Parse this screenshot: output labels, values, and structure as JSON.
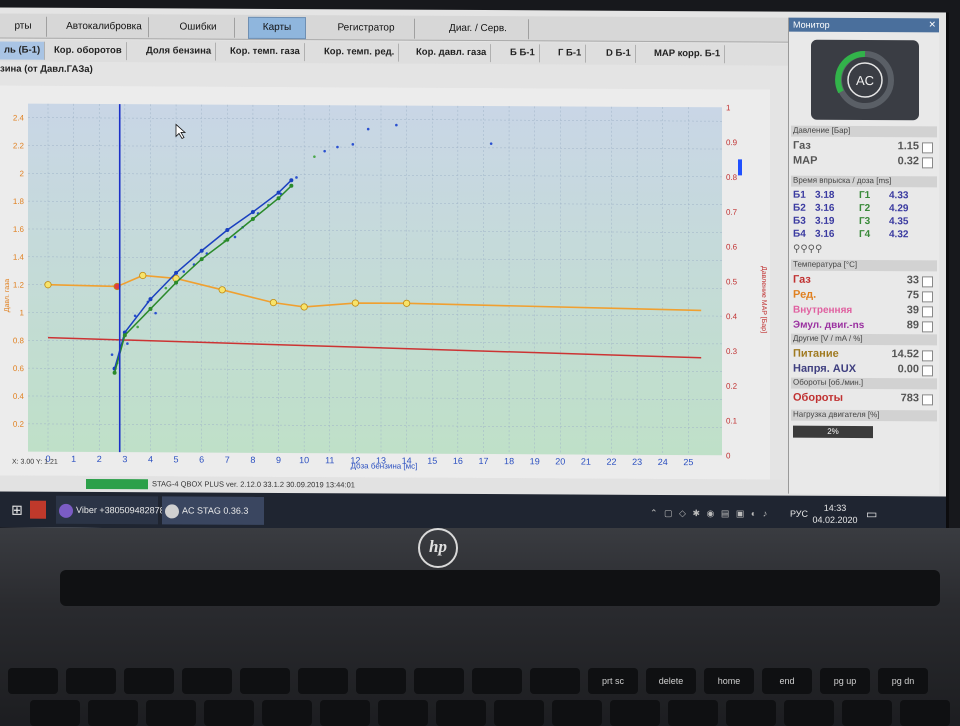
{
  "tabs": [
    "рты",
    "Автокалибровка",
    "Ошибки",
    "Карты",
    "Регистратор",
    "Диаг. / Серв."
  ],
  "active_tab": "Карты",
  "subtabs": [
    "ль (Б-1)",
    "Кор. оборотов",
    "Доля бензина",
    "Кор. темп. газа",
    "Кор. темп. ред.",
    "Кор. давл. газа",
    "Б Б-1",
    "Г Б-1",
    "D Б-1",
    "MAP корр. Б-1"
  ],
  "subtab_row2": "зина (от Давл.ГАЗа)",
  "left_axis_label": "Давл. газа",
  "right_axis_label": "Давление MAP [Бар]",
  "coord_readout": "X: 3.00   Y: 1.21",
  "status_text": "STAG-4 QBOX PLUS  ver. 2.12.0  33.1.2   30.09.2019 13:44:01",
  "chart_data": {
    "type": "line",
    "xlabel": "Доза бензина [мс]",
    "x_ticks": [
      0,
      1,
      2,
      3,
      4,
      5,
      6,
      7,
      8,
      9,
      10,
      11,
      12,
      13,
      14,
      15,
      16,
      17,
      18,
      19,
      20,
      21,
      22,
      23,
      24,
      25
    ],
    "y_left_ticks": [
      "2.4",
      "2.2",
      "2",
      "1.8",
      "1.6",
      "1.4",
      "1.2",
      "1",
      "0.8",
      "0.6",
      "0.4",
      "0.2"
    ],
    "y_right_ticks": [
      "1",
      "0.9",
      "0.8",
      "0.7",
      "0.6",
      "0.5",
      "0.4",
      "0.3",
      "0.2",
      "0.1",
      "0"
    ],
    "xlim": [
      0,
      26
    ],
    "ylim_left": [
      0,
      2.5
    ],
    "ylim_right": [
      0,
      1
    ],
    "cursor_x": 2.8,
    "series": [
      {
        "name": "",
        "color": "#f0a030",
        "axis": "left",
        "x": [
          0,
          2.7,
          3.7,
          5.0,
          6.8,
          8.8,
          10.0,
          12.0,
          14.0,
          25.5
        ],
        "y": [
          1.2,
          1.19,
          1.27,
          1.25,
          1.17,
          1.08,
          1.05,
          1.08,
          1.08,
          1.04
        ]
      },
      {
        "name": "",
        "color": "#cc3333",
        "axis": "left",
        "x": [
          0,
          25.5
        ],
        "y": [
          0.82,
          0.7
        ]
      },
      {
        "name": "",
        "color": "#1a40c0",
        "axis": "left",
        "x": [
          2.6,
          3.0,
          4.0,
          5.0,
          6.0,
          7.0,
          8.0,
          9.0,
          9.5
        ],
        "y": [
          0.6,
          0.86,
          1.1,
          1.29,
          1.45,
          1.6,
          1.73,
          1.87,
          1.96
        ]
      },
      {
        "name": "",
        "color": "#2a8a2a",
        "axis": "left",
        "x": [
          2.6,
          3.0,
          4.0,
          5.0,
          6.0,
          7.0,
          8.0,
          9.0,
          9.5
        ],
        "y": [
          0.57,
          0.84,
          1.03,
          1.22,
          1.39,
          1.53,
          1.68,
          1.83,
          1.92
        ]
      }
    ],
    "scatter_points": [
      [
        2.5,
        0.7
      ],
      [
        2.7,
        0.64
      ],
      [
        3.1,
        0.78
      ],
      [
        3.4,
        0.98
      ],
      [
        3.9,
        1.08
      ],
      [
        4.6,
        1.18
      ],
      [
        5.3,
        1.3
      ],
      [
        6.2,
        1.43
      ],
      [
        6.9,
        1.52
      ],
      [
        7.6,
        1.62
      ],
      [
        8.2,
        1.72
      ],
      [
        8.6,
        1.78
      ],
      [
        9.1,
        1.86
      ],
      [
        9.7,
        1.98
      ],
      [
        10.4,
        2.13
      ],
      [
        10.8,
        2.17
      ],
      [
        11.3,
        2.2
      ],
      [
        11.9,
        2.22
      ],
      [
        12.5,
        2.33
      ],
      [
        13.6,
        2.36
      ],
      [
        17.3,
        2.23
      ],
      [
        3.5,
        0.9
      ],
      [
        4.2,
        1.0
      ],
      [
        5.7,
        1.35
      ],
      [
        7.3,
        1.55
      ]
    ]
  },
  "monitor": {
    "title": "Монитор",
    "sections": {
      "pressure": "Давление [Бар]",
      "injection": "Время впрыска / доза [ms]",
      "temperature": "Температура [°C]",
      "other": "Другие [V / mA / %]",
      "rpm": "Обороты [об./мин.]",
      "load": "Нагрузка двигателя [%]"
    },
    "pressure_rows": [
      {
        "label": "Газ",
        "value": "1.15"
      },
      {
        "label": "MAP",
        "value": "0.32"
      }
    ],
    "injection_rows": [
      {
        "b": "Б1",
        "bv": "3.18",
        "g": "Г1",
        "gv": "4.33"
      },
      {
        "b": "Б2",
        "bv": "3.16",
        "g": "Г2",
        "gv": "4.29"
      },
      {
        "b": "Б3",
        "bv": "3.19",
        "g": "Г3",
        "gv": "4.35"
      },
      {
        "b": "Б4",
        "bv": "3.16",
        "g": "Г4",
        "gv": "4.32"
      }
    ],
    "temp_rows": [
      {
        "label": "Газ",
        "value": "33",
        "color": "#c03030"
      },
      {
        "label": "Ред.",
        "value": "75",
        "color": "#e08020"
      },
      {
        "label": "Внутренняя",
        "value": "39",
        "color": "#e060a0"
      },
      {
        "label": "Эмул. двиг.-ns",
        "value": "89",
        "color": "#9a30a0"
      }
    ],
    "other_rows": [
      {
        "label": "Питание",
        "value": "14.52",
        "color": "#a07a20"
      },
      {
        "label": "Напря. AUX",
        "value": "0.00",
        "color": "#404080"
      }
    ],
    "rpm_row": {
      "label": "Обороты",
      "value": "783"
    },
    "load_value": "2%",
    "load_fraction": 0.02
  },
  "taskbar": {
    "viber": "Viber +380509482878",
    "acstag": "AC STAG 0.36.3",
    "lang": "РУС",
    "time": "14:33",
    "date": "04.02.2020"
  },
  "laptop_brand": "hp",
  "keyboard_keys": [
    "prt sc",
    "delete",
    "home",
    "end",
    "pg up",
    "pg dn"
  ]
}
